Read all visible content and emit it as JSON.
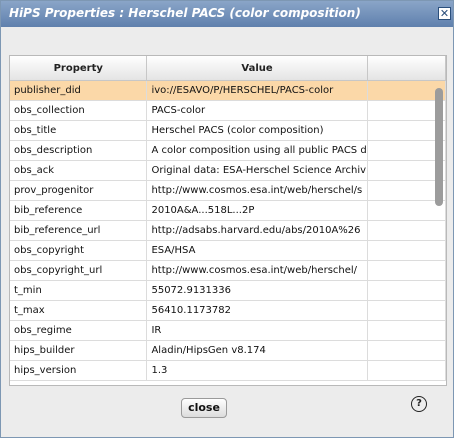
{
  "window": {
    "title": "HiPS Properties : Herschel PACS (color composition)"
  },
  "table": {
    "columns": [
      "Property",
      "Value"
    ],
    "rows": [
      {
        "property": "publisher_did",
        "value": "ivo://ESAVO/P/HERSCHEL/PACS-color"
      },
      {
        "property": "obs_collection",
        "value": "PACS-color"
      },
      {
        "property": "obs_title",
        "value": "Herschel PACS (color composition)"
      },
      {
        "property": "obs_description",
        "value": "A color composition using all public PACS d"
      },
      {
        "property": "obs_ack",
        "value": "Original data: ESA-Herschel Science Archiv"
      },
      {
        "property": "prov_progenitor",
        "value": "http://www.cosmos.esa.int/web/herschel/s"
      },
      {
        "property": "bib_reference",
        "value": "2010A&A...518L...2P"
      },
      {
        "property": "bib_reference_url",
        "value": "http://adsabs.harvard.edu/abs/2010A%26"
      },
      {
        "property": "obs_copyright",
        "value": "ESA/HSA"
      },
      {
        "property": "obs_copyright_url",
        "value": "http://www.cosmos.esa.int/web/herschel/"
      },
      {
        "property": "t_min",
        "value": "55072.9131336"
      },
      {
        "property": "t_max",
        "value": "56410.1173782"
      },
      {
        "property": "obs_regime",
        "value": "IR"
      },
      {
        "property": "hips_builder",
        "value": "Aladin/HipsGen v8.174"
      },
      {
        "property": "hips_version",
        "value": "1.3"
      }
    ],
    "selected_row": 0
  },
  "buttons": {
    "close_label": "close",
    "help_label": "?",
    "window_close_label": "✕"
  },
  "icons": {
    "window_close": "close-icon",
    "help": "help-icon"
  },
  "colors": {
    "titlebar": "#6b8bb8",
    "selected_row": "#fbd8a8"
  }
}
